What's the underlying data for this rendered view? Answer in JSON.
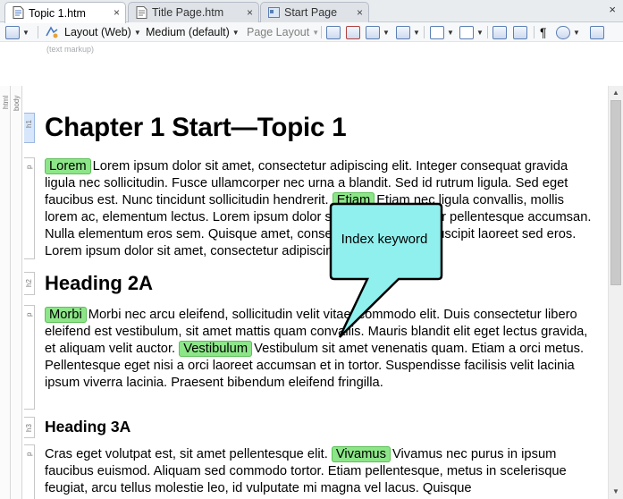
{
  "tabs": [
    {
      "label": "Topic 1.htm",
      "active": true,
      "icon": "topic-file-icon"
    },
    {
      "label": "Title Page.htm",
      "active": false,
      "icon": "topic-file-icon"
    },
    {
      "label": "Start Page",
      "active": false,
      "icon": "start-page-icon"
    }
  ],
  "tab_close_glyph": "×",
  "toolbar": {
    "layout_label": "Layout (Web)",
    "medium_label": "Medium (default)",
    "page_layout_label": "Page Layout",
    "pilcrow": "¶",
    "text_markup_hint": "(text markup)"
  },
  "structure": {
    "html_label": "html",
    "body_label": "body",
    "tags": [
      "h1",
      "p",
      "h2",
      "p",
      "h3",
      "p"
    ]
  },
  "doc": {
    "h1": "Chapter 1 Start—Topic 1",
    "p1": {
      "kw1": "Lorem",
      "text1": "Lorem ipsum dolor sit amet, consectetur adipiscing elit. Integer consequat gravida ligula nec sollicitudin. Fusce ullamcorper nec urna a blandit. Sed id rutrum ligula. Sed eget faucibus est. Nunc tincidunt sollicitudin hendrerit.",
      "kw2": "Etiam",
      "text2": "Etiam nec ligula convallis, mollis lorem ac, elementum lectus. Lorem ipsum dolor sit amet, consectetur pellentesque accumsan. Nulla elementum eros sem. Quisque amet, consectetur adipiscing suscipit laoreet sed eros. Lorem ipsum dolor sit amet, consectetur adipiscing elit."
    },
    "h2": "Heading 2A",
    "p2": {
      "kw1": "Morbi",
      "text1": "Morbi nec arcu eleifend, sollicitudin velit vitae, commodo elit. Duis consectetur libero eleifend est vestibulum, sit amet mattis quam convallis. Mauris blandit elit eget lectus gravida, et aliquam velit auctor.",
      "kw2": "Vestibulum",
      "text2": "Vestibulum sit amet venenatis quam. Etiam a orci metus. Pellentesque eget nisi a orci laoreet accumsan et in tortor. Suspendisse facilisis velit lacinia ipsum viverra lacinia. Praesent bibendum eleifend fringilla."
    },
    "h3": "Heading 3A",
    "p3": {
      "text0": "Cras eget volutpat est, sit amet pellentesque elit.",
      "kw1": "Vivamus",
      "text1": "Vivamus nec purus in ipsum faucibus euismod. Aliquam sed commodo tortor. Etiam pellentesque, metus in scelerisque feugiat, arcu tellus molestie leo, id vulputate mi magna vel lacus. Quisque"
    }
  },
  "callout": {
    "text": "Index keyword",
    "fill": "#8ff0ee",
    "stroke": "#000000"
  },
  "colors": {
    "keyword_bg": "#8ce688",
    "h1_struct_bg": "#d7e6fb"
  }
}
